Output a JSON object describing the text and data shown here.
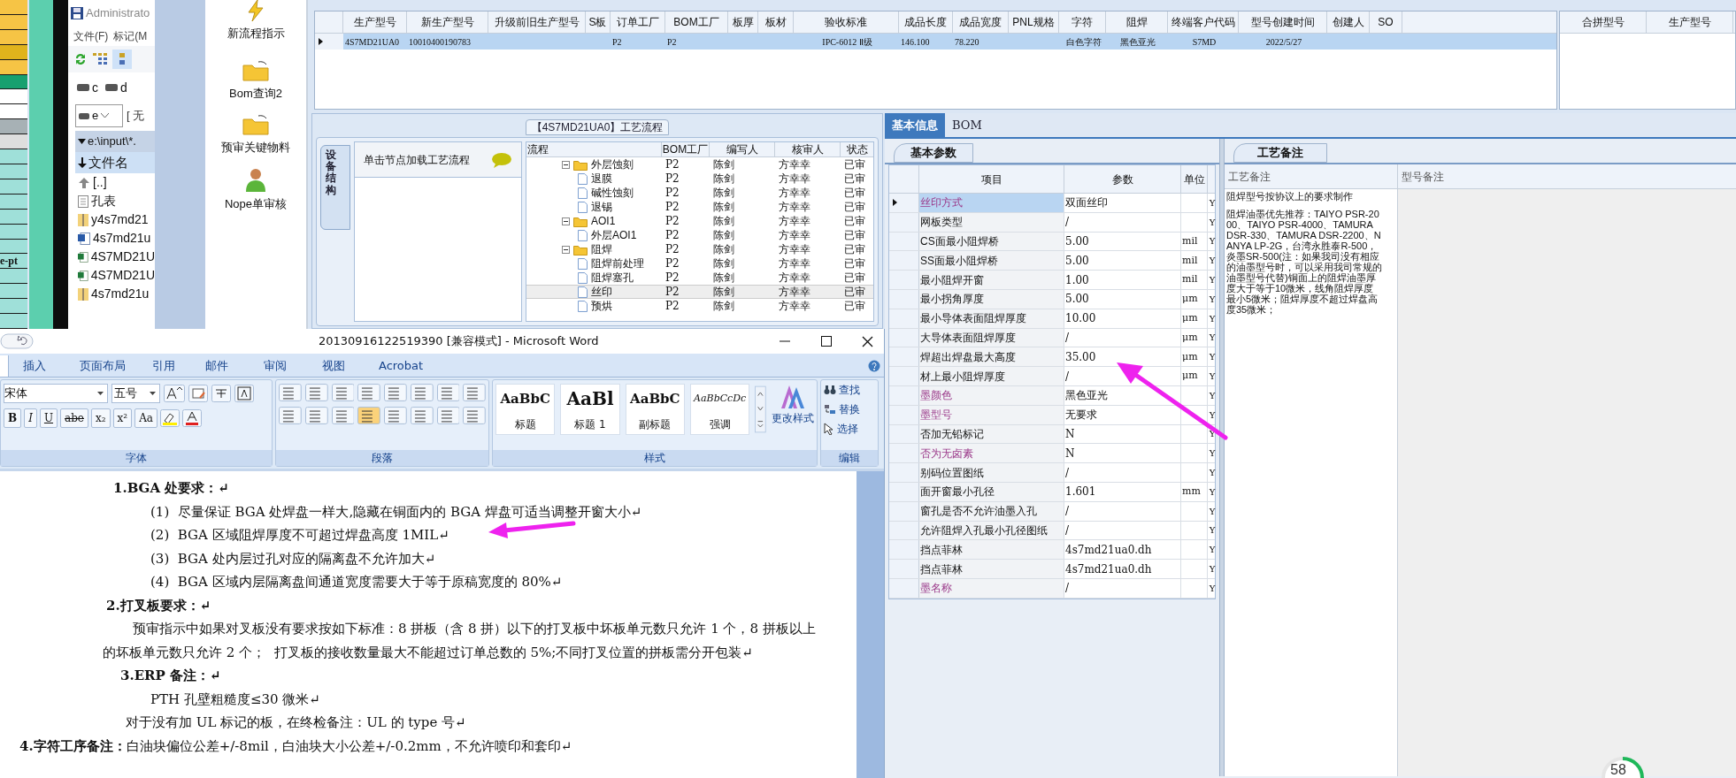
{
  "left_strip": {
    "label": "e-pt"
  },
  "file_manager": {
    "title": "Administrato",
    "menu": [
      "文件(F)",
      "标记(M"
    ],
    "drives": [
      "c",
      "d"
    ],
    "drive_select": "e",
    "volume_label": "[ 无",
    "path": "e:\\input\\*.",
    "column": "文件名",
    "files": [
      {
        "name": "[..]",
        "kind": "up"
      },
      {
        "name": "孔表",
        "kind": "doc"
      },
      {
        "name": "y4s7md21",
        "kind": "zip"
      },
      {
        "name": "4s7md21u",
        "kind": "word"
      },
      {
        "name": "4S7MD21U",
        "kind": "excel"
      },
      {
        "name": "4S7MD21U",
        "kind": "excel"
      },
      {
        "name": "4s7md21u",
        "kind": "zip"
      }
    ]
  },
  "launcher": [
    {
      "label": "新流程指示",
      "kind": "bolt"
    },
    {
      "label": "Bom查询2",
      "kind": "folder"
    },
    {
      "label": "预审关键物料",
      "kind": "folder"
    },
    {
      "label": "Nope单审核",
      "kind": "user"
    }
  ],
  "main_table": {
    "columns": [
      "生产型号",
      "新生产型号",
      "升级前旧生产型号",
      "S板",
      "订单工厂",
      "BOM工厂",
      "板厚",
      "板材",
      "验收标准",
      "成品长度",
      "成品宽度",
      "PNL规格",
      "字符",
      "阻焊",
      "终端客户代码",
      "型号创建时间",
      "创建人",
      "SO"
    ],
    "rows": [
      {
        "selected": true,
        "cells": [
          "4S7MD21UA0",
          "10010400190783",
          null,
          null,
          "P2",
          "P2",
          null,
          null,
          "IPC-6012 Ⅱ级",
          "146.100",
          "78.220",
          null,
          "白色字符",
          "黑色亚光",
          "S7MD",
          "2022/5/27",
          null,
          null
        ]
      }
    ]
  },
  "merge_table": {
    "columns": [
      "合拼型号",
      "生产型号"
    ]
  },
  "process": {
    "title": "【4S7MD21UA0】工艺流程",
    "side_tab": "设备结构",
    "hint": "单击节点加载工艺流程",
    "columns": [
      "流程",
      "BOM工厂",
      "编写人",
      "核审人",
      "状态"
    ],
    "tree": [
      {
        "label": "外层蚀刻",
        "kind": "folder",
        "expanded": true,
        "selected": false,
        "bom": "P2",
        "writer": "陈剑",
        "reviewer": "方幸幸",
        "status": "已审",
        "children": [
          {
            "label": "退膜",
            "kind": "file",
            "selected": false,
            "bom": "P2",
            "writer": "陈剑",
            "reviewer": "方幸幸",
            "status": "已审"
          },
          {
            "label": "碱性蚀刻",
            "kind": "file",
            "selected": false,
            "bom": "P2",
            "writer": "陈剑",
            "reviewer": "方幸幸",
            "status": "已审"
          },
          {
            "label": "退锡",
            "kind": "file",
            "selected": false,
            "bom": "P2",
            "writer": "陈剑",
            "reviewer": "方幸幸",
            "status": "已审"
          }
        ]
      },
      {
        "label": "AOI1",
        "kind": "folder",
        "expanded": true,
        "selected": false,
        "bom": "P2",
        "writer": "陈剑",
        "reviewer": "方幸幸",
        "status": "已审",
        "children": [
          {
            "label": "外层AOI1",
            "kind": "file",
            "selected": false,
            "bom": "P2",
            "writer": "陈剑",
            "reviewer": "方幸幸",
            "status": "已审"
          }
        ]
      },
      {
        "label": "阻焊",
        "kind": "folder",
        "expanded": true,
        "selected": false,
        "bom": "P2",
        "writer": "陈剑",
        "reviewer": "方幸幸",
        "status": "已审",
        "children": [
          {
            "label": "阻焊前处理",
            "kind": "file",
            "selected": false,
            "bom": "P2",
            "writer": "陈剑",
            "reviewer": "方幸幸",
            "status": "已审"
          },
          {
            "label": "阻焊塞孔",
            "kind": "file",
            "selected": false,
            "bom": "P2",
            "writer": "陈剑",
            "reviewer": "方幸幸",
            "status": "已审"
          },
          {
            "label": "丝印",
            "kind": "file",
            "selected": true,
            "bom": "P2",
            "writer": "陈剑",
            "reviewer": "方幸幸",
            "status": "已审"
          },
          {
            "label": "预烘",
            "kind": "file",
            "selected": false,
            "bom": "P2",
            "writer": "陈剑",
            "reviewer": "方幸幸",
            "status": "已审"
          }
        ]
      }
    ]
  },
  "basic_info": {
    "tabs": [
      {
        "label": "基本信息",
        "selected": true
      },
      {
        "label": "BOM",
        "selected": false
      }
    ],
    "subtab": "基本参数",
    "columns": [
      "项目",
      "参数",
      "单位"
    ],
    "rows": [
      {
        "item": "丝印方式",
        "value": "双面丝印",
        "flag": "Y",
        "emphasis": true,
        "selected": true
      },
      {
        "item": "网板类型",
        "value": "/",
        "flag": "Y",
        "emphasis": false,
        "selected": false
      },
      {
        "item": "CS面最小阻焊桥",
        "value": "5.00",
        "unit": "mil",
        "flag": "Y",
        "emphasis": false,
        "selected": false
      },
      {
        "item": "SS面最小阻焊桥",
        "value": "5.00",
        "unit": "mil",
        "flag": "Y",
        "emphasis": false,
        "selected": false
      },
      {
        "item": "最小阻焊开窗",
        "value": "1.00",
        "unit": "mil",
        "flag": "Y",
        "emphasis": false,
        "selected": false
      },
      {
        "item": "最小拐角厚度",
        "value": "5.00",
        "unit": "μm",
        "flag": "Y",
        "emphasis": false,
        "selected": false
      },
      {
        "item": "最小导体表面阻焊厚度",
        "value": "10.00",
        "unit": "μm",
        "flag": "Y",
        "emphasis": false,
        "selected": false
      },
      {
        "item": "大导体表面阻焊厚度",
        "value": "/",
        "unit": "μm",
        "flag": "Y",
        "emphasis": false,
        "selected": false
      },
      {
        "item": "焊超出焊盘最大高度",
        "value": "35.00",
        "unit": "μm",
        "flag": "Y",
        "emphasis": false,
        "selected": false
      },
      {
        "item": "材上最小阻焊厚度",
        "value": "/",
        "unit": "μm",
        "flag": "Y",
        "emphasis": false,
        "selected": false
      },
      {
        "item": "墨颜色",
        "value": "黑色亚光",
        "flag": "Y",
        "emphasis": true,
        "selected": false
      },
      {
        "item": "墨型号",
        "value": "无要求",
        "flag": "Y",
        "emphasis": true,
        "selected": false
      },
      {
        "item": "否加无铅标记",
        "value": "N",
        "flag": "Y",
        "emphasis": false,
        "selected": false
      },
      {
        "item": "否为无卤素",
        "value": "N",
        "flag": "Y",
        "emphasis": true,
        "selected": false
      },
      {
        "item": "别码位置图纸",
        "value": "/",
        "flag": "Y",
        "emphasis": false,
        "selected": false
      },
      {
        "item": "面开窗最小孔径",
        "value": "1.601",
        "unit": "mm",
        "flag": "Y",
        "emphasis": false,
        "selected": false
      },
      {
        "item": "窗孔是否不允许油墨入孔",
        "value": "/",
        "flag": "Y",
        "emphasis": false,
        "selected": false
      },
      {
        "item": "允许阻焊入孔最小孔径图纸",
        "value": "/",
        "flag": "Y",
        "emphasis": false,
        "selected": false
      },
      {
        "item": "挡点菲林",
        "value": "4s7md21ua0.dh",
        "flag": "Y",
        "emphasis": false,
        "selected": false
      },
      {
        "item": "挡点菲林",
        "value": "4s7md21ua0.dh",
        "flag": "Y",
        "emphasis": false,
        "selected": false
      },
      {
        "item": "墨名称",
        "value": "/",
        "flag": "Y",
        "emphasis": true,
        "selected": false
      }
    ]
  },
  "notes": {
    "tab": "工艺备注",
    "columns": [
      "工艺备注",
      "型号备注"
    ],
    "paragraphs": [
      "阻焊型号按协议上的要求制作",
      "阻焊油墨优先推荐：TAIYO PSR-2000、TAIYO PSR-4000、TAMURA DSR-330、TAMURA DSR-2200、NANYA LP-2G，台湾永胜泰R-500，炎墨SR-500(注：如果我司没有相应的油墨型号时，可以采用我司常规的油墨型号代替)铜面上的阻焊油墨厚度大于等于10微米，线角阻焊厚度最小5微米；阻焊厚度不超过焊盘高度35微米；"
    ]
  },
  "word": {
    "title": "20130916122519390 [兼容模式] - Microsoft Word",
    "tabs": [
      "插入",
      "页面布局",
      "引用",
      "邮件",
      "审阅",
      "视图",
      "Acrobat"
    ],
    "font_name": "宋体",
    "font_size": "五号",
    "format_buttons": [
      "B",
      "I",
      "U",
      "abe",
      "x₂",
      "x²",
      "Aa"
    ],
    "styles": [
      {
        "sample": "AaBbC",
        "label": "标题",
        "kind": "title"
      },
      {
        "sample": "AaBl",
        "label": "标题 1",
        "kind": "heading"
      },
      {
        "sample": "AaBbC",
        "label": "副标题",
        "kind": "subtitle"
      },
      {
        "sample": "AaBbCcDc",
        "label": "强调",
        "kind": "emphasis"
      }
    ],
    "change_styles": "更改样式",
    "editing": [
      "查找",
      "替换",
      "选择"
    ],
    "groups": [
      "字体",
      "段落",
      "样式",
      "编辑"
    ],
    "paragraphs": [
      {
        "kind": "heading",
        "text": "1.BGA 处要求：↵"
      },
      {
        "kind": "item",
        "text": "(1)  尽量保证 BGA 处焊盘一样大,隐藏在铜面内的 BGA 焊盘可适当调整开窗大小↵"
      },
      {
        "kind": "item",
        "text": "(2)  BGA 区域阻焊厚度不可超过焊盘高度 1MIL↵"
      },
      {
        "kind": "item",
        "text": "(3)  BGA 处内层过孔对应的隔离盘不允许加大↵"
      },
      {
        "kind": "item",
        "text": "(4)  BGA 区域内层隔离盘间通道宽度需要大于等于原稿宽度的 80%↵"
      },
      {
        "kind": "heading2",
        "text": "2.打叉板要求：↵"
      },
      {
        "kind": "body",
        "text": "预审指示中如果对叉板没有要求按如下标准：8 拼板（含 8 拼）以下的打叉板中坏板单元数只允许 1 个，8 拼板以上的坏板单元数只允许 2 个；  打叉板的接收数量最大不能超过订单总数的 5%;不同打叉位置的拼板需分开包装↵"
      },
      {
        "kind": "heading3",
        "text": "3.ERP 备注：↵"
      },
      {
        "kind": "item",
        "text": "PTH 孔壁粗糙度≤30 微米↵"
      },
      {
        "kind": "line",
        "text": "对于没有加 UL 标记的板，在终检备注：UL 的 type 号↵"
      },
      {
        "kind": "final",
        "text": "**4.字符工序备注：**白油块偏位公差+/-8mil，白油块大小公差+/-0.2mm，不允许喷印和套印↵"
      }
    ]
  },
  "progress_badge": {
    "text": "58"
  }
}
